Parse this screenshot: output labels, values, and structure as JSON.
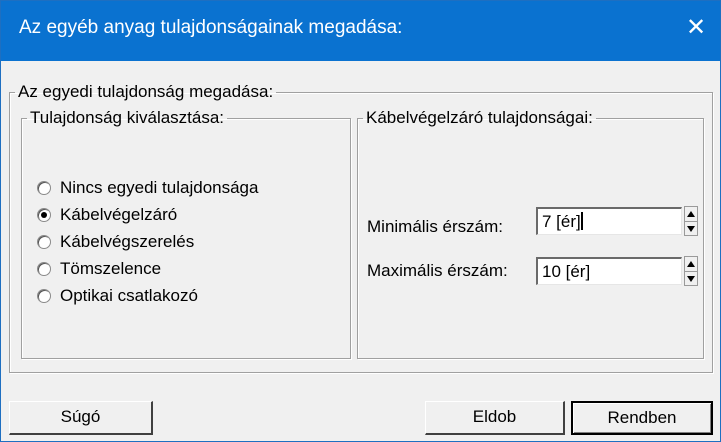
{
  "dialog": {
    "title": "Az egyéb anyag tulajdonságainak megadása:",
    "close_glyph": "✕"
  },
  "outer_group": {
    "legend": "Az egyedi tulajdonság megadása:"
  },
  "left_group": {
    "legend": "Tulajdonság kiválasztása:",
    "options": [
      {
        "label": "Nincs egyedi tulajdonsága",
        "selected": false
      },
      {
        "label": "Kábelvégelzáró",
        "selected": true
      },
      {
        "label": "Kábelvégszerelés",
        "selected": false
      },
      {
        "label": "Tömszelence",
        "selected": false
      },
      {
        "label": "Optikai csatlakozó",
        "selected": false
      }
    ]
  },
  "right_group": {
    "legend": "Kábelvégelzáró tulajdonságai:",
    "min_label": "Minimális érszám:",
    "min_value": "7 [ér]",
    "max_label": "Maximális érszám:",
    "max_value": "10 [ér]"
  },
  "buttons": {
    "help": "Súgó",
    "cancel": "Eldob",
    "ok": "Rendben"
  }
}
